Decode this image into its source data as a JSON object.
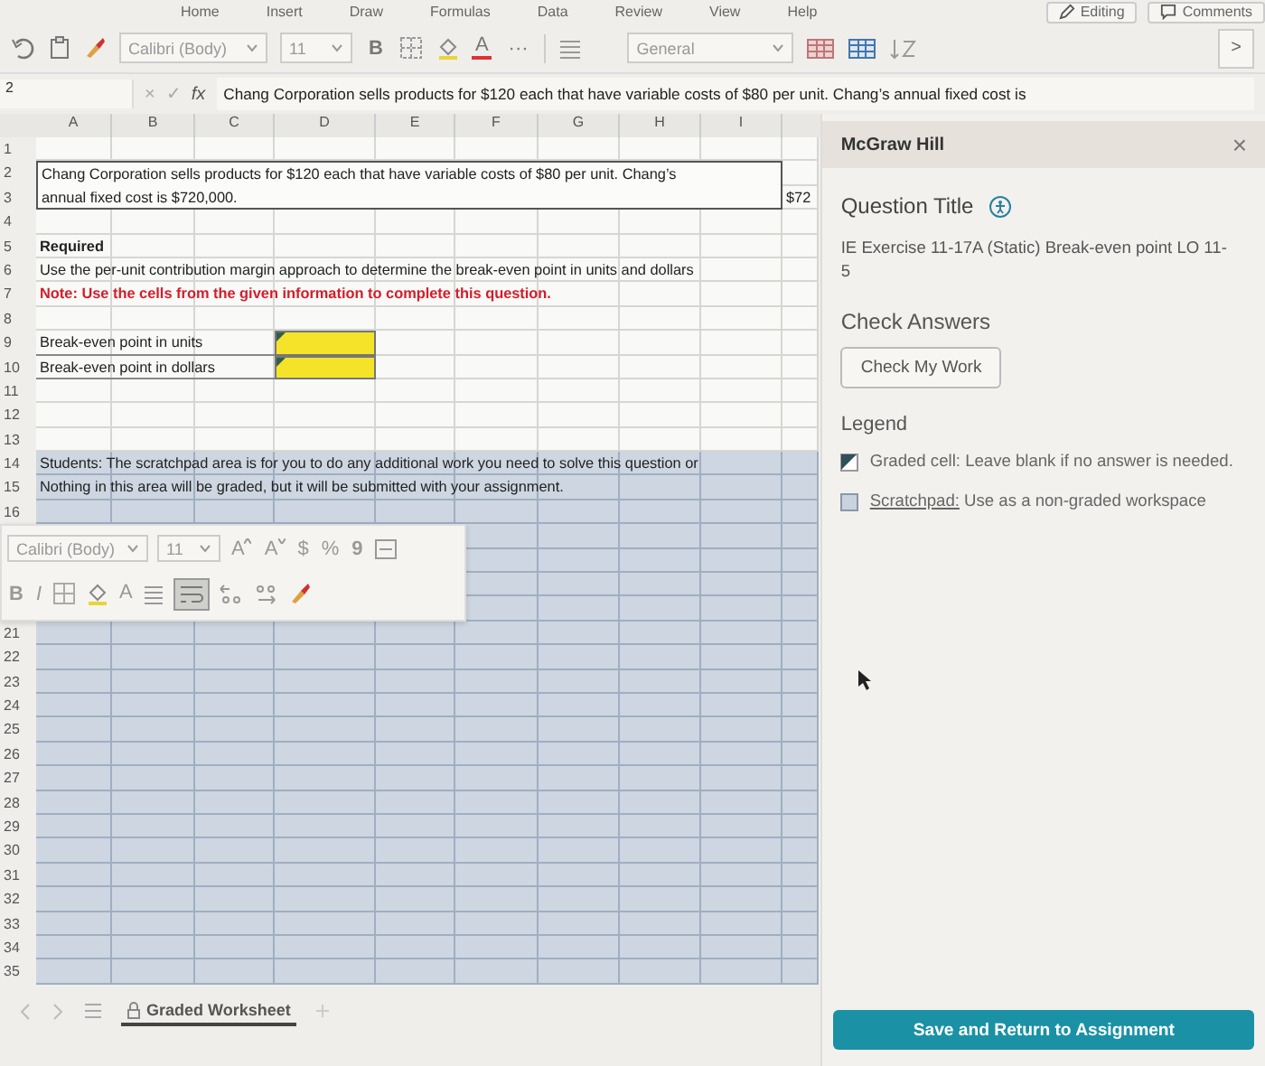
{
  "ribbon_tabs": [
    "Home",
    "Insert",
    "Draw",
    "Formulas",
    "Data",
    "Review",
    "View",
    "Help"
  ],
  "mode_button": "Editing",
  "comments_button": "Comments",
  "toolbar": {
    "font": "Calibri (Body)",
    "size": "11",
    "bold": "B",
    "font_color": "A",
    "more": "···",
    "number_format": "General",
    "next": ">"
  },
  "formula_bar": {
    "name_box": "2",
    "cancel": "×",
    "enter": "✓",
    "fx": "fx",
    "formula": "Chang Corporation sells products for $120 each that have variable costs of $80 per unit. Chang’s annual fixed cost is"
  },
  "columns": [
    "A",
    "B",
    "C",
    "D",
    "E",
    "F",
    "G",
    "H",
    "I"
  ],
  "rows": [
    {
      "num": "1",
      "scratchpad": false,
      "cells": []
    },
    {
      "num": "2",
      "scratchpad": false,
      "cells": [
        {
          "kind": "problem-top",
          "text": "Chang Corporation sells products for $120 each that have variable costs of $80 per unit. Chang’s"
        }
      ]
    },
    {
      "num": "3",
      "scratchpad": false,
      "cells": [
        {
          "kind": "problem-bottom",
          "text": "annual fixed cost is $720,000."
        },
        {
          "kind": "side-value",
          "text": "$72"
        }
      ]
    },
    {
      "num": "4",
      "scratchpad": false,
      "cells": []
    },
    {
      "num": "5",
      "scratchpad": false,
      "cells": [
        {
          "kind": "heading",
          "text": "Required"
        }
      ]
    },
    {
      "num": "6",
      "scratchpad": false,
      "cells": [
        {
          "kind": "text",
          "text": "Use the per-unit contribution margin approach to determine the break-even point in units and dollars"
        }
      ]
    },
    {
      "num": "7",
      "scratchpad": false,
      "cells": [
        {
          "kind": "note",
          "text": "Note: Use the cells from the given information to complete this question."
        }
      ]
    },
    {
      "num": "8",
      "scratchpad": false,
      "cells": []
    },
    {
      "num": "9",
      "scratchpad": false,
      "cells": [
        {
          "kind": "label",
          "text": "Break-even point in units"
        },
        {
          "kind": "input",
          "graded": true
        }
      ]
    },
    {
      "num": "10",
      "scratchpad": false,
      "cells": [
        {
          "kind": "label",
          "text": "Break-even point in dollars"
        },
        {
          "kind": "input",
          "graded": true
        }
      ]
    },
    {
      "num": "11",
      "scratchpad": false,
      "cells": []
    },
    {
      "num": "12",
      "scratchpad": false,
      "cells": []
    },
    {
      "num": "13",
      "scratchpad": false,
      "cells": []
    },
    {
      "num": "14",
      "scratchpad": true,
      "cells": [
        {
          "kind": "text",
          "text": "Students: The scratchpad area is for you to do any additional work you need to solve this question or"
        }
      ]
    },
    {
      "num": "15",
      "scratchpad": true,
      "cells": [
        {
          "kind": "text",
          "text": "Nothing in this area will be graded, but it will be submitted with your assignment."
        }
      ]
    },
    {
      "num": "16",
      "scratchpad": true,
      "cells": []
    },
    {
      "scratchpad": true,
      "cells": []
    },
    {
      "scratchpad": true,
      "cells": []
    },
    {
      "scratchpad": true,
      "cells": []
    },
    {
      "scratchpad": true,
      "cells": []
    },
    {
      "num": "21",
      "scratchpad": true,
      "cells": []
    },
    {
      "num": "22",
      "scratchpad": true,
      "cells": []
    },
    {
      "num": "23",
      "scratchpad": true,
      "cells": []
    },
    {
      "num": "24",
      "scratchpad": true,
      "cells": []
    },
    {
      "num": "25",
      "scratchpad": true,
      "cells": []
    },
    {
      "num": "26",
      "scratchpad": true,
      "cells": []
    },
    {
      "num": "27",
      "scratchpad": true,
      "cells": []
    },
    {
      "num": "28",
      "scratchpad": true,
      "cells": []
    },
    {
      "num": "29",
      "scratchpad": true,
      "cells": []
    },
    {
      "num": "30",
      "scratchpad": true,
      "cells": []
    },
    {
      "num": "31",
      "scratchpad": true,
      "cells": []
    },
    {
      "num": "32",
      "scratchpad": true,
      "cells": []
    },
    {
      "num": "33",
      "scratchpad": true,
      "cells": []
    },
    {
      "num": "34",
      "scratchpad": true,
      "cells": []
    },
    {
      "num": "35",
      "scratchpad": true,
      "cells": []
    }
  ],
  "mini_toolbar": {
    "font": "Calibri (Body)",
    "size": "11",
    "grow": "A",
    "shrink": "A",
    "currency": "$",
    "percent": "%",
    "comma": "9",
    "bold": "B",
    "italic": "I",
    "font_color": "A",
    "wrap_selected": true
  },
  "sheet_tabs": [
    {
      "label": "Graded Worksheet",
      "selected": true,
      "locked": true
    }
  ],
  "panel": {
    "brand": "McGraw Hill",
    "close": "×",
    "question_heading": "Question Title",
    "question_title": "IE Exercise 11-17A (Static) Break-even point LO 11-5",
    "check_heading": "Check Answers",
    "check_button": "Check My Work",
    "legend_heading": "Legend",
    "legend": [
      {
        "kind": "graded",
        "term": "Graded cell:",
        "text": "Leave blank if no answer is needed."
      },
      {
        "kind": "scratchpad",
        "term": "Scratchpad:",
        "text": "Use as a non-graded workspace"
      }
    ],
    "save_button": "Save and Return to Assignment"
  }
}
